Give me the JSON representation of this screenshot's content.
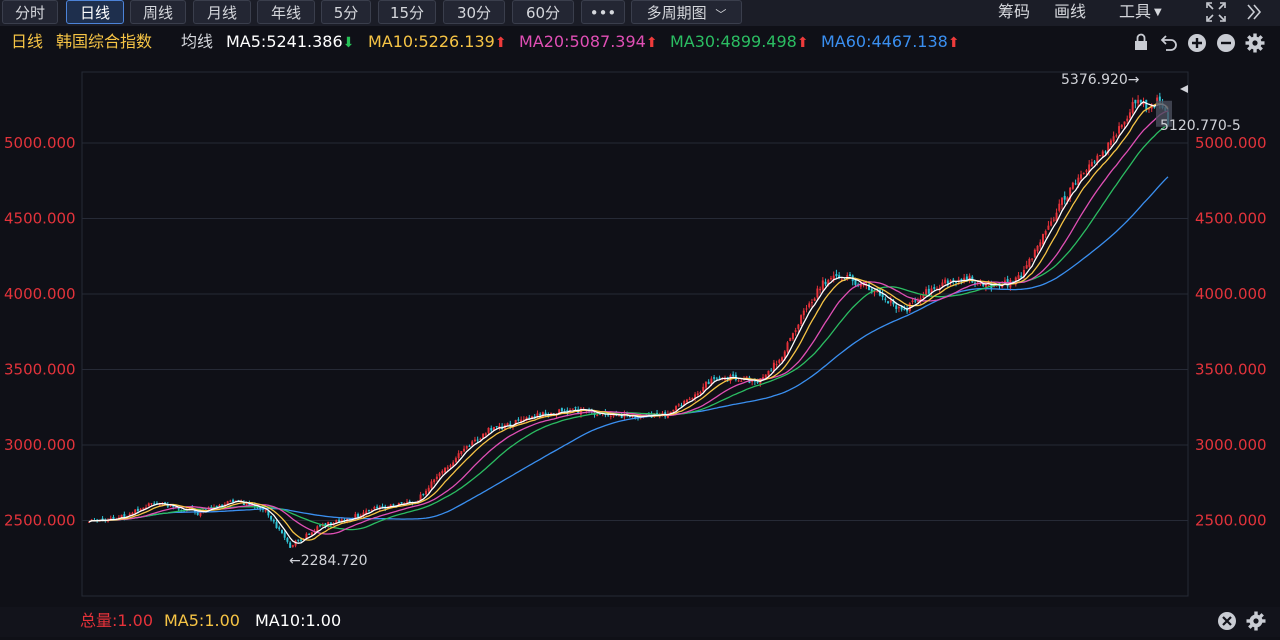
{
  "toolbar": {
    "periods": [
      {
        "label": "分时",
        "active": false
      },
      {
        "label": "日线",
        "active": true
      },
      {
        "label": "周线",
        "active": false
      },
      {
        "label": "月线",
        "active": false
      },
      {
        "label": "年线",
        "active": false
      },
      {
        "label": "5分",
        "active": false
      },
      {
        "label": "15分",
        "active": false
      },
      {
        "label": "30分",
        "active": false
      },
      {
        "label": "60分",
        "active": false
      },
      {
        "label": "•••",
        "active": false
      }
    ],
    "multi_period": "多周期图",
    "right_items": [
      "筹码",
      "画线",
      "工具"
    ],
    "collapse_icon": "double-chevron-right-icon",
    "fullscreen_icon": "fullscreen-icon"
  },
  "legend": {
    "period": "日线",
    "index_name": "韩国综合指数",
    "ma_label": "均线",
    "ma": [
      {
        "text": "MA5:5241.386",
        "dir": "down",
        "color": "#ffffff"
      },
      {
        "text": "MA10:5226.139",
        "dir": "up",
        "color": "#f6c445"
      },
      {
        "text": "MA20:5087.394",
        "dir": "up",
        "color": "#e04fb5"
      },
      {
        "text": "MA30:4899.498",
        "dir": "up",
        "color": "#2bbd62"
      },
      {
        "text": "MA60:4467.138",
        "dir": "up",
        "color": "#3a8ff0"
      }
    ],
    "icons": [
      "lock-icon",
      "undo-icon",
      "zoom-in-icon",
      "zoom-out-icon",
      "settings-icon"
    ]
  },
  "annotations": {
    "high": "5376.920→",
    "low": "←2284.720",
    "last_price": "5120.770",
    "last_tag": "5120.770-5"
  },
  "volume": {
    "total_label": "总量:1.00",
    "ma5_label": "MA5:1.00",
    "ma10_label": "MA10:1.00",
    "icons": [
      "close-icon",
      "settings-icon"
    ]
  },
  "chart_data": {
    "type": "candlestick",
    "title": "韩国综合指数",
    "y_ticks": [
      "2500.000",
      "3000.000",
      "3500.000",
      "4000.000",
      "4500.000",
      "5000.000"
    ],
    "y_tick_values": [
      2500,
      3000,
      3500,
      4000,
      4500,
      5000
    ],
    "ylim": [
      2070,
      5430
    ],
    "grid": true,
    "colors": {
      "up": "#e5323a",
      "down": "#2fc4d6",
      "ma5": "#ffffff",
      "ma10": "#f6c445",
      "ma20": "#e04fb5",
      "ma30": "#2bbd62",
      "ma60": "#3a8ff0"
    },
    "close_path": [
      [
        0,
        2490
      ],
      [
        14,
        2530
      ],
      [
        22,
        2610
      ],
      [
        30,
        2600
      ],
      [
        40,
        2550
      ],
      [
        52,
        2620
      ],
      [
        60,
        2610
      ],
      [
        65,
        2560
      ],
      [
        70,
        2440
      ],
      [
        74,
        2330
      ],
      [
        78,
        2380
      ],
      [
        86,
        2470
      ],
      [
        96,
        2510
      ],
      [
        104,
        2580
      ],
      [
        112,
        2600
      ],
      [
        120,
        2620
      ],
      [
        128,
        2790
      ],
      [
        136,
        2930
      ],
      [
        146,
        3090
      ],
      [
        154,
        3130
      ],
      [
        165,
        3200
      ],
      [
        178,
        3230
      ],
      [
        190,
        3200
      ],
      [
        200,
        3190
      ],
      [
        212,
        3200
      ],
      [
        220,
        3290
      ],
      [
        228,
        3420
      ],
      [
        238,
        3450
      ],
      [
        246,
        3420
      ],
      [
        254,
        3560
      ],
      [
        262,
        3840
      ],
      [
        270,
        4070
      ],
      [
        274,
        4140
      ],
      [
        280,
        4100
      ],
      [
        286,
        4050
      ],
      [
        292,
        3980
      ],
      [
        300,
        3890
      ],
      [
        306,
        3990
      ],
      [
        316,
        4080
      ],
      [
        324,
        4100
      ],
      [
        334,
        4050
      ],
      [
        342,
        4100
      ],
      [
        350,
        4350
      ],
      [
        358,
        4620
      ],
      [
        366,
        4800
      ],
      [
        374,
        4960
      ],
      [
        380,
        5120
      ],
      [
        386,
        5300
      ],
      [
        390,
        5240
      ],
      [
        394,
        5280
      ],
      [
        397,
        5160
      ]
    ],
    "n_bars": 398,
    "last_close": 5120.77,
    "high": 5376.92,
    "low": 2284.72
  }
}
